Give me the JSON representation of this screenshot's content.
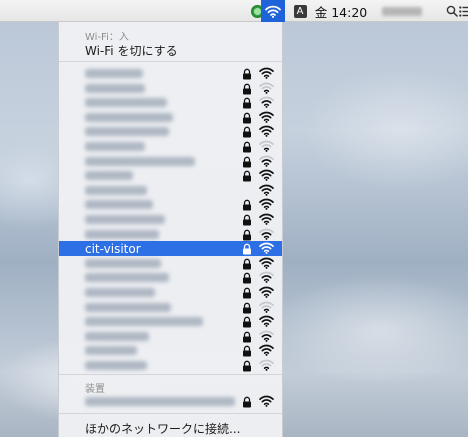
{
  "menubar": {
    "clock": "金 14:20",
    "input_source": "A",
    "icons": [
      "green-circle-icon",
      "wifi-icon",
      "input-source-icon",
      "spotlight-search-icon",
      "notification-center-icon"
    ]
  },
  "wifi_menu": {
    "status_text": "Wi-Fi：入",
    "turn_off_label": "Wi-Fi を切にする",
    "networks": [
      {
        "name": "",
        "locked": true,
        "signal": 3,
        "selected": false
      },
      {
        "name": "",
        "locked": true,
        "signal": 1,
        "selected": false
      },
      {
        "name": "",
        "locked": true,
        "signal": 2,
        "selected": false
      },
      {
        "name": "",
        "locked": true,
        "signal": 3,
        "selected": false
      },
      {
        "name": "",
        "locked": true,
        "signal": 3,
        "selected": false
      },
      {
        "name": "",
        "locked": true,
        "signal": 1,
        "selected": false
      },
      {
        "name": "",
        "locked": true,
        "signal": 2,
        "selected": false
      },
      {
        "name": "",
        "locked": true,
        "signal": 3,
        "selected": false
      },
      {
        "name": "",
        "locked": false,
        "signal": 3,
        "selected": false
      },
      {
        "name": "",
        "locked": true,
        "signal": 3,
        "selected": false
      },
      {
        "name": "",
        "locked": true,
        "signal": 3,
        "selected": false
      },
      {
        "name": "",
        "locked": true,
        "signal": 2,
        "selected": false
      },
      {
        "name": "cit-visitor",
        "locked": true,
        "signal": 3,
        "selected": true
      },
      {
        "name": "",
        "locked": true,
        "signal": 3,
        "selected": false
      },
      {
        "name": "",
        "locked": true,
        "signal": 2,
        "selected": false
      },
      {
        "name": "",
        "locked": true,
        "signal": 3,
        "selected": false
      },
      {
        "name": "",
        "locked": true,
        "signal": 1,
        "selected": false
      },
      {
        "name": "",
        "locked": true,
        "signal": 3,
        "selected": false
      },
      {
        "name": "",
        "locked": true,
        "signal": 2,
        "selected": false
      },
      {
        "name": "",
        "locked": true,
        "signal": 3,
        "selected": false
      },
      {
        "name": "",
        "locked": true,
        "signal": 1,
        "selected": false
      }
    ],
    "devices_label": "装置",
    "device": {
      "name": "",
      "locked": true,
      "signal": 3
    },
    "other_network_label": "ほかのネットワークに接続..."
  }
}
